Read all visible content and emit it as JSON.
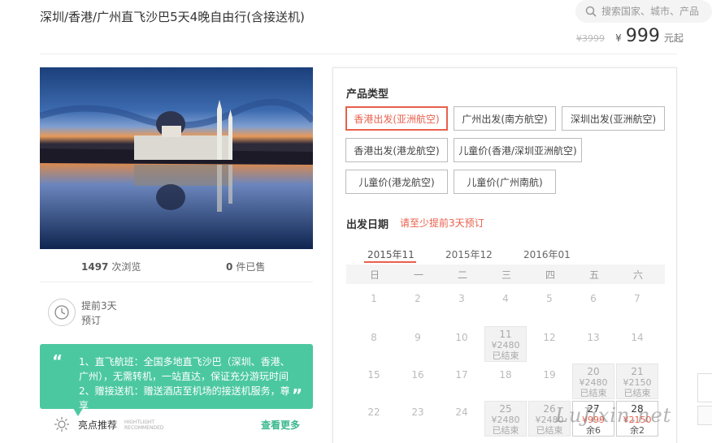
{
  "header": {
    "title": "深圳/香港/广州直飞沙巴5天4晚自由行(含接送机)",
    "search_placeholder": "搜索国家、城市、产品"
  },
  "price": {
    "original": "¥3999",
    "currency": "¥",
    "amount": "999",
    "suffix": "元起"
  },
  "stats": {
    "views_count": "1497",
    "views_label": "次浏览",
    "sold_count": "0",
    "sold_label": "件已售"
  },
  "advance": {
    "line1": "提前3天",
    "line2": "预订"
  },
  "highlights": {
    "text": "1、直飞航班：全国多地直飞沙巴（深圳、香港、广州），无需转机，一站直达，保证充分游玩时间 2、赠接送机：赠送酒店至机场的接送机服务，尊享",
    "open_quote": "“",
    "close_quote": "”",
    "recommend_label": "亮点推荐",
    "recommend_sub1": "HIGHTLIGHT",
    "recommend_sub2": "RECOMMENDED",
    "more_label": "查看更多"
  },
  "product": {
    "section_title": "产品类型",
    "options": [
      {
        "label": "香港出发(亚洲航空)"
      },
      {
        "label": "广州出发(南方航空)"
      },
      {
        "label": "深圳出发(亚洲航空)"
      },
      {
        "label": "香港出发(港龙航空)"
      },
      {
        "label": "儿童价(香港/深圳亚洲航空)"
      },
      {
        "label": "儿童价(港龙航空)"
      },
      {
        "label": "儿童价(广州南航)"
      }
    ],
    "selected_index": 0
  },
  "departure": {
    "section_title": "出发日期",
    "note": "请至少提前3天预订",
    "months": [
      "2015年11",
      "2015年12",
      "2016年01"
    ],
    "active_month": 0,
    "weekdays": [
      "日",
      "一",
      "二",
      "三",
      "四",
      "五",
      "六"
    ],
    "days": [
      {
        "d": "1"
      },
      {
        "d": "2"
      },
      {
        "d": "3"
      },
      {
        "d": "4"
      },
      {
        "d": "5"
      },
      {
        "d": "6"
      },
      {
        "d": "7"
      },
      {
        "d": "8"
      },
      {
        "d": "9"
      },
      {
        "d": "10"
      },
      {
        "d": "11",
        "price": "¥2480",
        "status": "已结束"
      },
      {
        "d": "12"
      },
      {
        "d": "13"
      },
      {
        "d": "14"
      },
      {
        "d": "15"
      },
      {
        "d": "16"
      },
      {
        "d": "17"
      },
      {
        "d": "18"
      },
      {
        "d": "19"
      },
      {
        "d": "20",
        "price": "¥2480",
        "status": "已结束"
      },
      {
        "d": "21",
        "price": "¥2150",
        "status": "已结束"
      },
      {
        "d": "22"
      },
      {
        "d": "23"
      },
      {
        "d": "24"
      },
      {
        "d": "25",
        "price": "¥2480",
        "status": "已结束"
      },
      {
        "d": "26",
        "price": "¥2480",
        "status": "已结束"
      },
      {
        "d": "27",
        "price": "¥999",
        "status": "余6",
        "open": true
      },
      {
        "d": "28",
        "price": "¥2150",
        "status": "余2",
        "open": true
      }
    ]
  },
  "watermark": "LuJixin.net",
  "colors": {
    "accent": "#e8604c",
    "highlight_bg": "#4cc8a0",
    "more_link": "#3ab88e"
  }
}
